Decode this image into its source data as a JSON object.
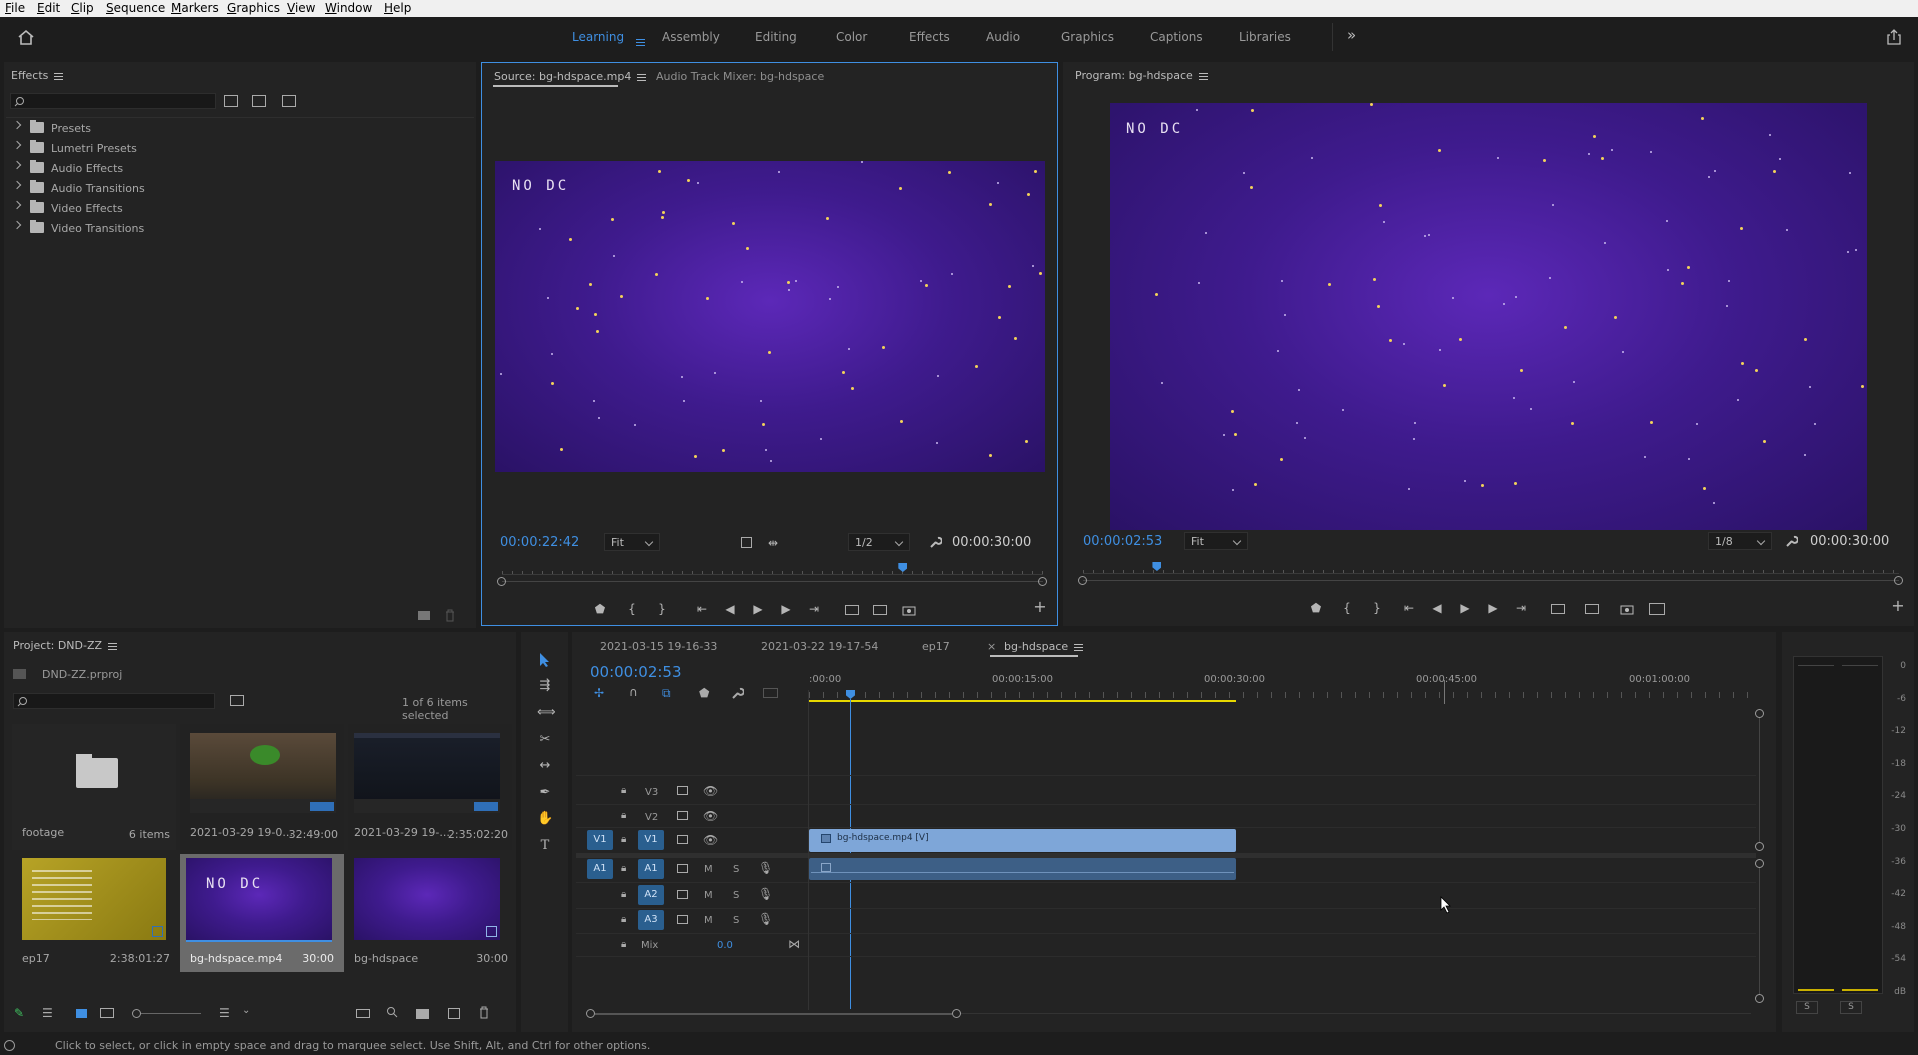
{
  "menu": [
    "File",
    "Edit",
    "Clip",
    "Sequence",
    "Markers",
    "Graphics",
    "View",
    "Window",
    "Help"
  ],
  "workspaces": [
    "Learning",
    "Assembly",
    "Editing",
    "Color",
    "Effects",
    "Audio",
    "Graphics",
    "Captions",
    "Libraries"
  ],
  "active_workspace": "Learning",
  "overflow_glyph": "»",
  "effects": {
    "title": "Effects",
    "items": [
      "Presets",
      "Lumetri Presets",
      "Audio Effects",
      "Audio Transitions",
      "Video Effects",
      "Video Transitions"
    ],
    "toolbar_icons": [
      "new-preset-bin-icon",
      "32-bit-icon",
      "yuv-icon"
    ]
  },
  "source": {
    "tab": "Source: bg-hdspace.mp4",
    "tab2": "Audio Track Mixer: bg-hdspace",
    "timecode": "00:00:22:42",
    "fit": "Fit",
    "resolution": "1/2",
    "duration": "00:00:30:00",
    "overlay_text": "NO DC",
    "playhead_fraction": 0.74
  },
  "program": {
    "tab": "Program: bg-hdspace",
    "timecode": "00:00:02:53",
    "fit": "Fit",
    "resolution": "1/8",
    "duration": "00:00:30:00",
    "overlay_text": "NO DC",
    "playhead_fraction": 0.09
  },
  "project": {
    "title": "Project: DND-ZZ",
    "file": "DND-ZZ.prproj",
    "selection": "1 of 6 items selected",
    "items": [
      {
        "name": "footage",
        "meta": "6 items",
        "kind": "folder"
      },
      {
        "name": "2021-03-29 19-0...",
        "meta": "32:49:00",
        "kind": "game"
      },
      {
        "name": "2021-03-29 19-...",
        "meta": "2:35:02:20",
        "kind": "desktop"
      },
      {
        "name": "ep17",
        "meta": "2:38:01:27",
        "kind": "yellow"
      },
      {
        "name": "bg-hdspace.mp4",
        "meta": "30:00",
        "kind": "space-text",
        "selected": true
      },
      {
        "name": "bg-hdspace",
        "meta": "30:00",
        "kind": "space"
      }
    ]
  },
  "timeline": {
    "tabs": [
      "2021-03-15 19-16-33",
      "2021-03-22 19-17-54",
      "ep17",
      "bg-hdspace"
    ],
    "active_tab": "bg-hdspace",
    "timecode": "00:00:02:53",
    "ruler": [
      ":00:00",
      "00:00:15:00",
      "00:00:30:00",
      "00:00:45:00",
      "00:01:00:00"
    ],
    "video_tracks": [
      "V3",
      "V2",
      "V1"
    ],
    "audio_tracks": [
      "A1",
      "A2",
      "A3"
    ],
    "source_v": "V1",
    "source_a": "A1",
    "mute": "M",
    "solo": "S",
    "mix_label": "Mix",
    "mix_value": "0.0",
    "clip_video": "bg-hdspace.mp4 [V]"
  },
  "meter": {
    "scale": [
      "0",
      "-6",
      "-12",
      "-18",
      "-24",
      "-30",
      "-36",
      "-42",
      "-48",
      "-54",
      "dB"
    ],
    "solo_left": "S",
    "solo_right": "S"
  },
  "status": "Click to select, or click in empty space and drag to marquee select. Use Shift, Alt, and Ctrl for other options.",
  "colors": {
    "accent": "#3f8fe2",
    "clip_video": "#7ea6d8",
    "clip_audio": "#3d5f86",
    "work_area": "#e8d800"
  }
}
